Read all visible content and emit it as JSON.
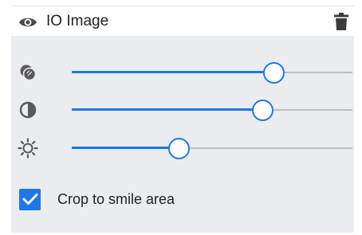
{
  "layer": {
    "title": "IO Image",
    "visible": true
  },
  "icons": {
    "visibility": "eye-icon",
    "delete": "trash-icon",
    "slider_1": "opacity-icon",
    "slider_2": "contrast-icon",
    "slider_3": "brightness-icon",
    "checkbox": "checkmark-icon"
  },
  "sliders": [
    {
      "name": "opacity",
      "value": 0.72
    },
    {
      "name": "contrast",
      "value": 0.68
    },
    {
      "name": "brightness",
      "value": 0.38
    }
  ],
  "crop": {
    "label": "Crop to smile area",
    "checked": true
  },
  "colors": {
    "accent": "#1e78e6",
    "panel_background": "#eaecef",
    "track": "#bdbdbd",
    "icon": "#555555"
  }
}
